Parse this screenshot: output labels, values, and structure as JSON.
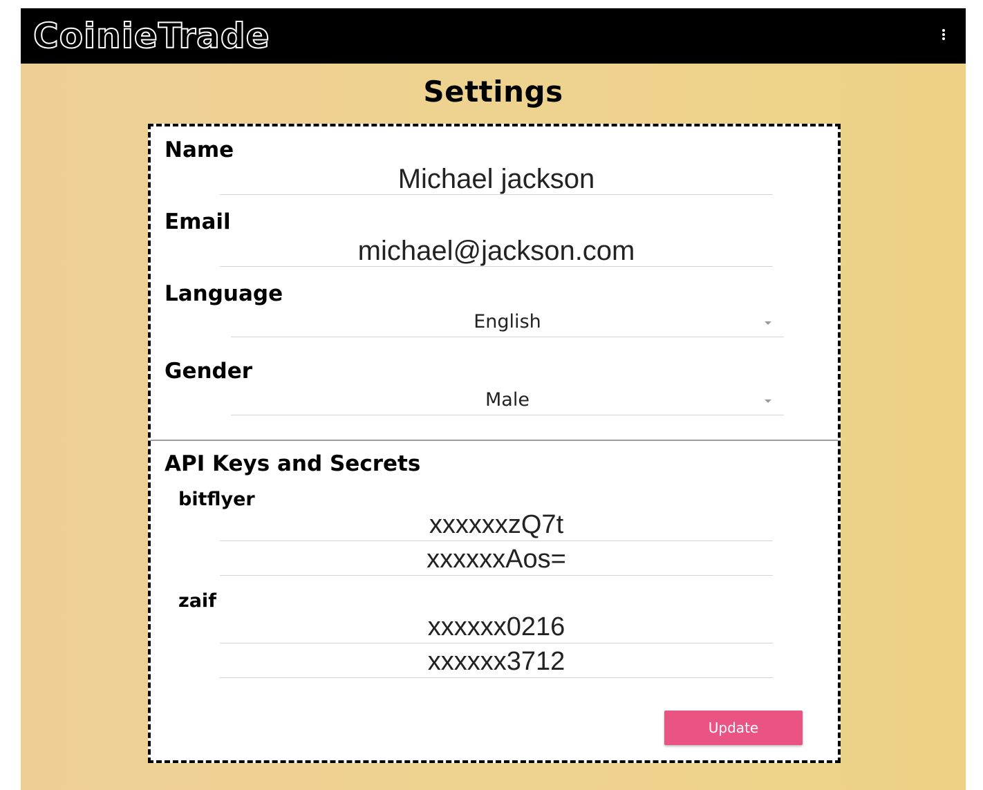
{
  "app": {
    "brand": "CoinieTrade",
    "colors": {
      "topbar": "#000000",
      "background": "#eed38f",
      "panel": "#ffffff",
      "accent": "#ea5482"
    },
    "menu_icon": "more-vert-icon"
  },
  "page": {
    "title": "Settings"
  },
  "profile": {
    "name_label": "Name",
    "name_value": "Michael jackson",
    "email_label": "Email",
    "email_value": "michael@jackson.com",
    "language_label": "Language",
    "language_selected": "English",
    "gender_label": "Gender",
    "gender_selected": "Male"
  },
  "api": {
    "heading": "API Keys and Secrets",
    "exchanges": [
      {
        "name": "bitflyer",
        "key": "xxxxxxzQ7t",
        "secret": "xxxxxxAos="
      },
      {
        "name": "zaif",
        "key": "xxxxxx0216",
        "secret": "xxxxxx3712"
      }
    ]
  },
  "actions": {
    "update_label": "Update"
  }
}
